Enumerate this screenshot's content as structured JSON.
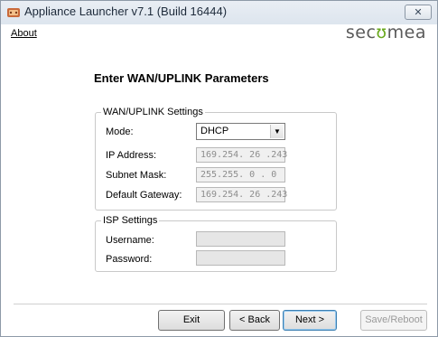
{
  "window": {
    "title": "Appliance Launcher v7.1 (Build 16444)",
    "close_label": "✕"
  },
  "menu": {
    "about_label": "About"
  },
  "logo": {
    "prefix": "sec",
    "mid": "ʊ",
    "suffix": "mea"
  },
  "page": {
    "heading": "Enter WAN/UPLINK Parameters"
  },
  "wan": {
    "legend": "WAN/UPLINK Settings",
    "mode_label": "Mode:",
    "mode_value": "DHCP",
    "ip_label": "IP Address:",
    "ip_value": "169.254. 26 .243",
    "subnet_label": "Subnet Mask:",
    "subnet_value": "255.255. 0 . 0",
    "gateway_label": "Default Gateway:",
    "gateway_value": "169.254. 26 .243"
  },
  "isp": {
    "legend": "ISP Settings",
    "username_label": "Username:",
    "username_value": "",
    "password_label": "Password:",
    "password_value": ""
  },
  "buttons": {
    "exit": "Exit",
    "back": "< Back",
    "next": "Next >",
    "save": "Save/Reboot"
  },
  "icons": {
    "app": "appliance-launcher-icon",
    "close": "close-icon",
    "dropdown": "chevron-down-icon"
  },
  "colors": {
    "logo_accent": "#6aa91e",
    "logo_text": "#5a5a5a"
  }
}
